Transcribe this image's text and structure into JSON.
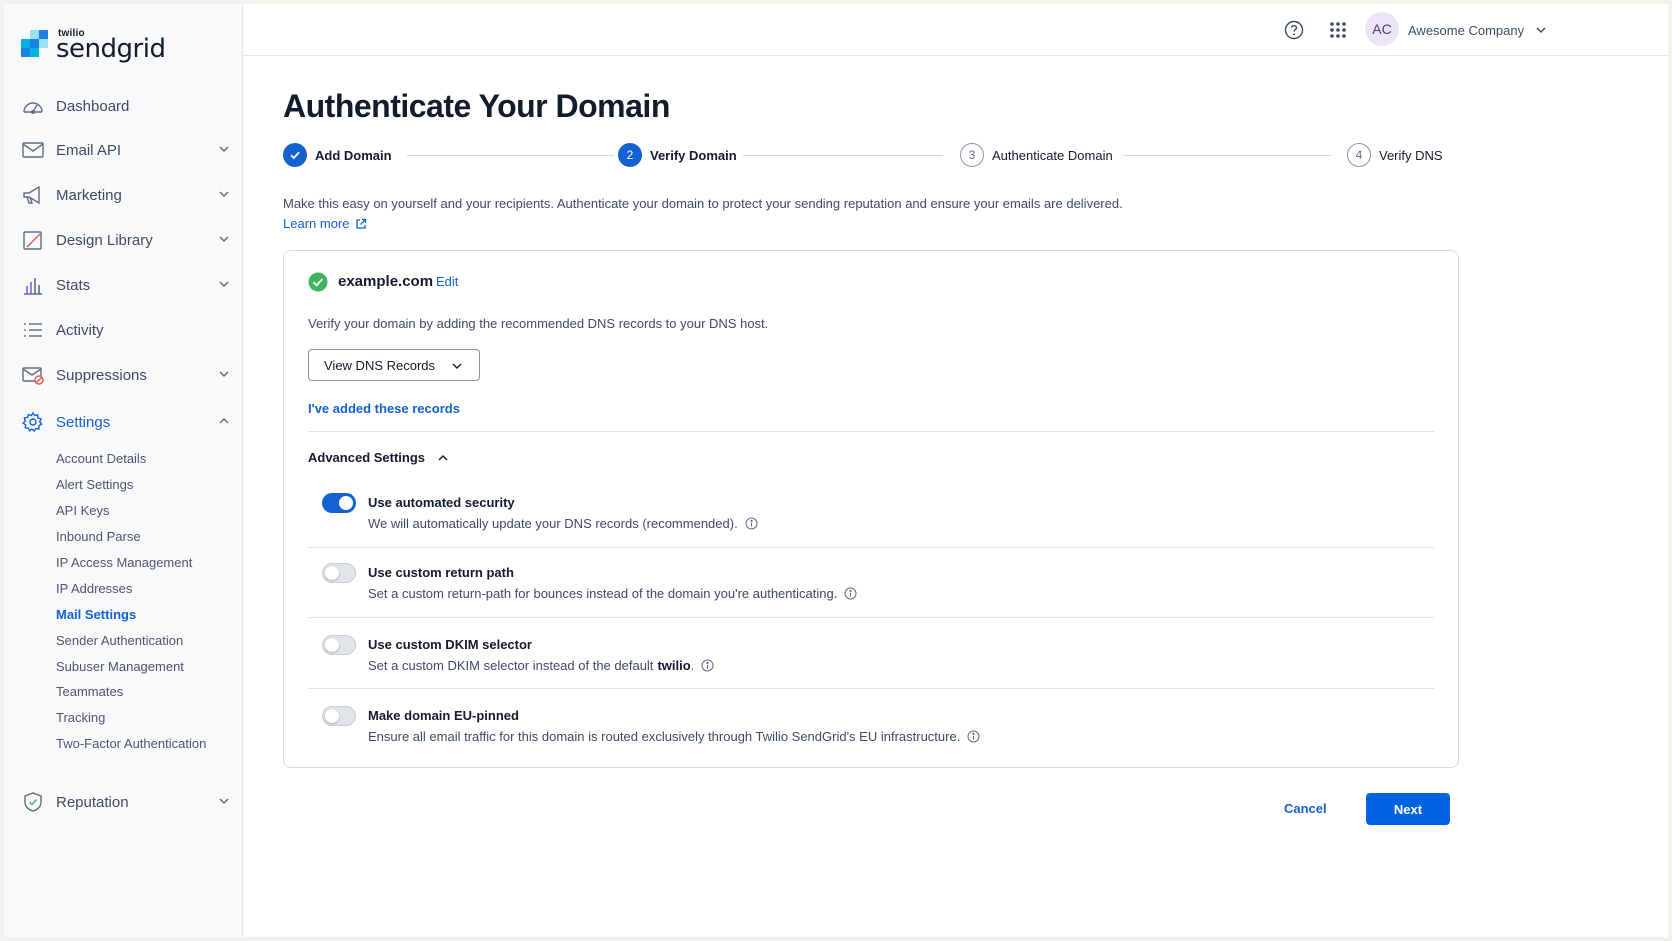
{
  "brand": {
    "small": "twilio",
    "big": "sendgrid"
  },
  "sidebar": {
    "items": [
      {
        "label": "Dashboard",
        "icon": "dashboard-icon"
      },
      {
        "label": "Email API",
        "icon": "mail-icon"
      },
      {
        "label": "Marketing",
        "icon": "megaphone-icon"
      },
      {
        "label": "Design Library",
        "icon": "design-icon"
      },
      {
        "label": "Stats",
        "icon": "stats-icon"
      },
      {
        "label": "Activity",
        "icon": "activity-icon"
      },
      {
        "label": "Suppressions",
        "icon": "suppressions-icon"
      },
      {
        "label": "Settings",
        "icon": "gear-icon"
      },
      {
        "label": "Reputation",
        "icon": "shield-icon"
      }
    ],
    "settings_sub": [
      "Account Details",
      "Alert Settings",
      "API Keys",
      "Inbound Parse",
      "IP Access Management",
      "IP Addresses",
      "Mail Settings",
      "Sender Authentication",
      "Subuser Management",
      "Teammates",
      "Tracking",
      "Two-Factor Authentication"
    ],
    "active_sub": "Mail Settings"
  },
  "header": {
    "avatar_initials": "AC",
    "company": "Awesome Company"
  },
  "page": {
    "title": "Authenticate Your Domain",
    "intro": "Make this easy on yourself and your recipients. Authenticate your domain to protect your sending reputation and ensure your emails are delivered.",
    "learn_more": "Learn more"
  },
  "steps": [
    {
      "number": "1",
      "label": "Add Domain",
      "state": "done"
    },
    {
      "number": "2",
      "label": "Verify Domain",
      "state": "current"
    },
    {
      "number": "3",
      "label": "Authenticate Domain",
      "state": "todo"
    },
    {
      "number": "4",
      "label": "Verify DNS",
      "state": "todo"
    }
  ],
  "card": {
    "domain": "example.com",
    "edit": "Edit",
    "verify_text": "Verify your domain by adding the recommended DNS records to your DNS host.",
    "dns_button": "View DNS Records",
    "added_link": "I've added these records",
    "advanced_title": "Advanced Settings"
  },
  "settings": [
    {
      "title": "Use automated security",
      "desc": "We will automatically update your DNS records (recommended).",
      "enabled": true
    },
    {
      "title": "Use custom return path",
      "desc": "Set a custom return-path for bounces instead of the domain you're authenticating.",
      "enabled": false
    },
    {
      "title": "Use custom DKIM selector",
      "desc": "Set a custom DKIM selector instead of the default",
      "desc_bold": "twilio",
      "desc_end": ".",
      "enabled": false
    },
    {
      "title": "Make domain EU-pinned",
      "desc": "Ensure all email traffic for this domain is routed exclusively through Twilio SendGrid's EU infrastructure.",
      "enabled": false
    }
  ],
  "footer": {
    "cancel": "Cancel",
    "next": "Next"
  },
  "colors": {
    "accent": "#1461d2",
    "success": "#3cb55e",
    "primary_button": "#0263e0"
  }
}
